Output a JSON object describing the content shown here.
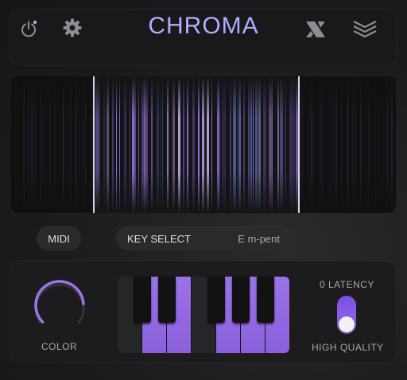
{
  "header": {
    "title": "CHROMA",
    "power_state": "on",
    "accent_gradient": [
      "#c3a8ff",
      "#9fb6ff"
    ]
  },
  "icons": {
    "power": "power-icon",
    "settings": "gear-icon",
    "logo_x": "x-logo-icon",
    "logo_w": "layers-logo-icon"
  },
  "controls": {
    "midi_label": "MIDI",
    "key_select_label": "KEY SELECT",
    "key_select_value": "E m-pent",
    "color_label": "COLOR",
    "color_value": 0.82,
    "latency_label": "0 LATENCY",
    "hq_label": "HIGH QUALITY",
    "hq_enabled": true
  },
  "keyboard": {
    "white_keys": [
      false,
      true,
      true,
      false,
      true,
      true,
      true
    ],
    "black_keys": [
      true,
      true,
      true,
      true,
      true
    ]
  },
  "colors": {
    "accent": "#8f66e4",
    "background": "#1c1c1e"
  }
}
